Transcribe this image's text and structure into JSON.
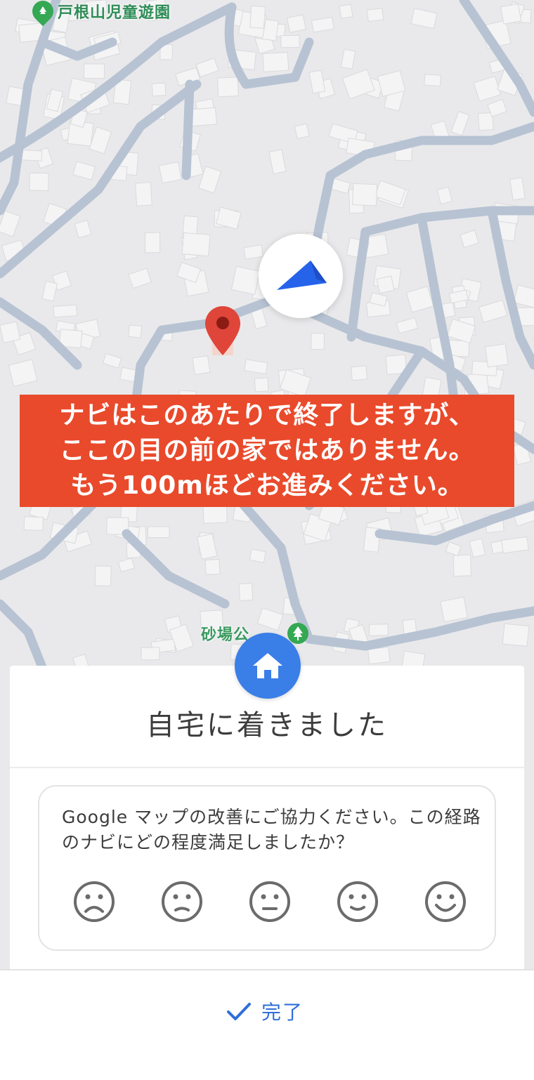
{
  "map": {
    "poi_top": {
      "label": "戸根山児童遊園",
      "icon": "tree-icon"
    },
    "poi_bottom": {
      "label": "砂場公",
      "icon": "tree-icon"
    },
    "nav_arrow_icon": "navigation-arrow-icon",
    "destination_icon": "red-map-pin-icon",
    "road_color": "#b7c3d3",
    "background_color": "#e9e9eb",
    "building_color": "#f3f3f4"
  },
  "banner": {
    "line1": "ナビはこのあたりで終了しますが、",
    "line2": "ここの目の前の家ではありません。",
    "line3": "もう100mほどお進みください。",
    "background": "#e94a2b"
  },
  "sheet": {
    "home_icon": "home-icon",
    "title": "自宅に着きました",
    "feedback": {
      "question": "Google マップの改善にご協力ください。この経路のナビにどの程度満足しましたか？",
      "faces": [
        "very-dissatisfied-face-icon",
        "dissatisfied-face-icon",
        "neutral-face-icon",
        "satisfied-face-icon",
        "very-satisfied-face-icon"
      ]
    }
  },
  "bottom": {
    "done_label": "完了",
    "done_icon": "checkmark-icon",
    "accent": "#2f6fd8"
  }
}
